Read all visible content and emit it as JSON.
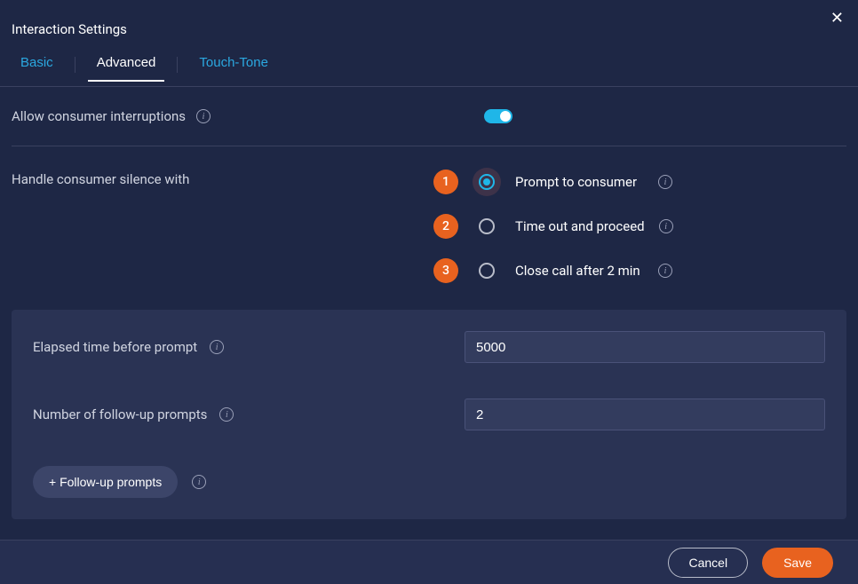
{
  "header": {
    "title": "Interaction Settings"
  },
  "tabs": {
    "basic": "Basic",
    "advanced": "Advanced",
    "touchtone": "Touch-Tone"
  },
  "settings": {
    "allow_interruptions": {
      "label": "Allow consumer interruptions",
      "value": true
    },
    "handle_silence": {
      "label": "Handle consumer silence with",
      "options": [
        {
          "num": "1",
          "label": "Prompt to consumer",
          "selected": true
        },
        {
          "num": "2",
          "label": "Time out and proceed",
          "selected": false
        },
        {
          "num": "3",
          "label": "Close call after 2 min",
          "selected": false
        }
      ]
    }
  },
  "panel": {
    "elapsed": {
      "label": "Elapsed time before prompt",
      "value": "5000"
    },
    "num_followups": {
      "label": "Number of follow-up prompts",
      "value": "2"
    },
    "followup_btn": "+ Follow-up prompts"
  },
  "footer": {
    "cancel": "Cancel",
    "save": "Save"
  }
}
